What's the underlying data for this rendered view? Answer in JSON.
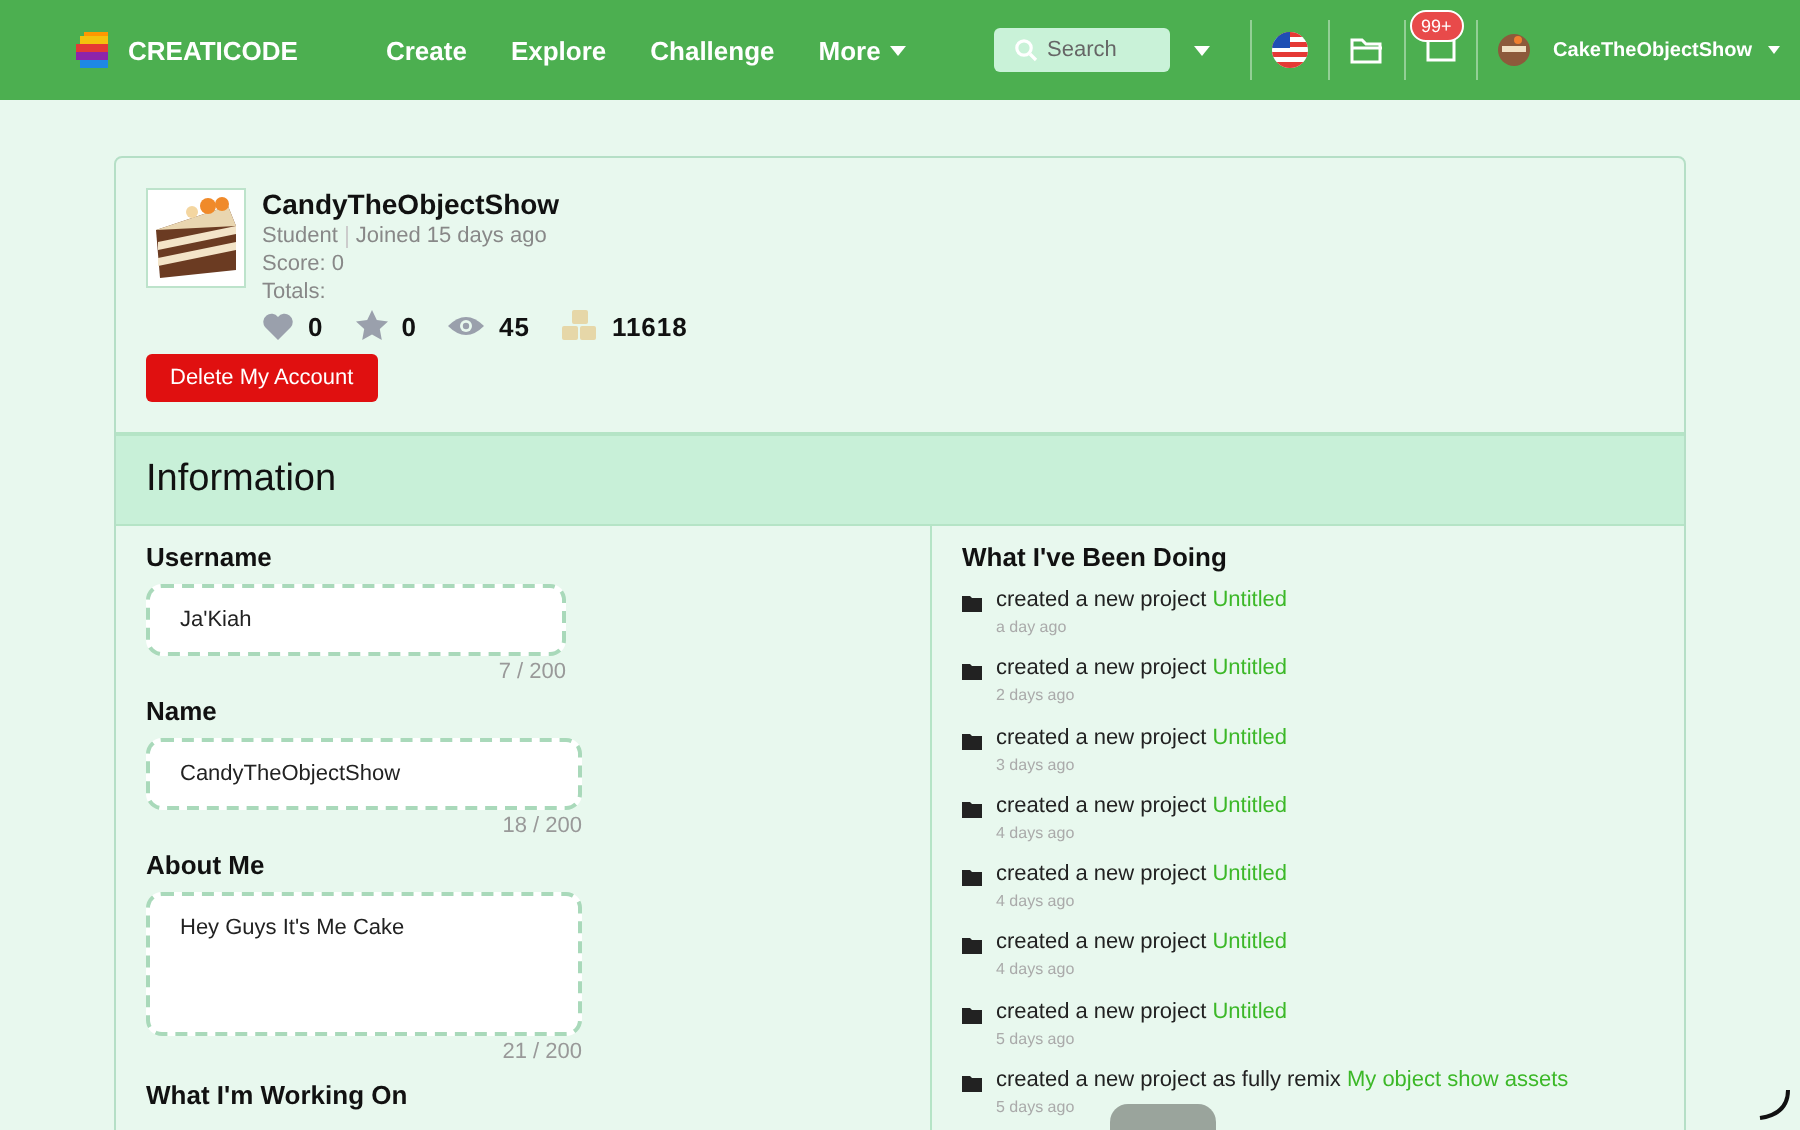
{
  "header": {
    "logo_text": "CREATICODE",
    "nav": [
      {
        "label": "Create",
        "kind": "link"
      },
      {
        "label": "Explore",
        "kind": "link"
      },
      {
        "label": "Challenge",
        "kind": "link"
      },
      {
        "label": "More",
        "kind": "dropdown"
      }
    ],
    "search": {
      "placeholder": "Search"
    },
    "notification_badge": "99+",
    "user_name": "CakeTheObjectShow"
  },
  "profile": {
    "name": "CandyTheObjectShow",
    "role": "Student",
    "joined": "Joined 15 days ago",
    "score": "Score: 0",
    "totals_label": "Totals:",
    "stats": [
      {
        "kind": "likes",
        "value": "0"
      },
      {
        "kind": "stars",
        "value": "0"
      },
      {
        "kind": "views",
        "value": "45"
      },
      {
        "kind": "coins",
        "value": "11618"
      }
    ],
    "delete_button": "Delete My Account"
  },
  "section_title": "Information",
  "fields": [
    {
      "label": "Username",
      "value": "Ja'Kiah",
      "counter": "7 / 200",
      "kind": "input"
    },
    {
      "label": "Name",
      "value": "CandyTheObjectShow",
      "counter": "18 / 200",
      "kind": "input"
    },
    {
      "label": "About Me",
      "value": "Hey Guys It's Me Cake",
      "counter": "21 / 200",
      "kind": "textarea"
    }
  ],
  "next_label": "What I'm Working On",
  "activity": {
    "title": "What I've Been Doing",
    "items": [
      {
        "text": "created a new project",
        "link": "Untitled",
        "time": "a day ago"
      },
      {
        "text": "created a new project",
        "link": "Untitled",
        "time": "2 days ago"
      },
      {
        "text": "created a new project",
        "link": "Untitled",
        "time": "3 days ago"
      },
      {
        "text": "created a new project",
        "link": "Untitled",
        "time": "4 days ago"
      },
      {
        "text": "created a new project",
        "link": "Untitled",
        "time": "4 days ago"
      },
      {
        "text": "created a new project",
        "link": "Untitled",
        "time": "4 days ago"
      },
      {
        "text": "created a new project",
        "link": "Untitled",
        "time": "5 days ago"
      },
      {
        "text": "created a new project as fully remix",
        "link": "My object show assets",
        "time": "5 days ago"
      }
    ]
  }
}
